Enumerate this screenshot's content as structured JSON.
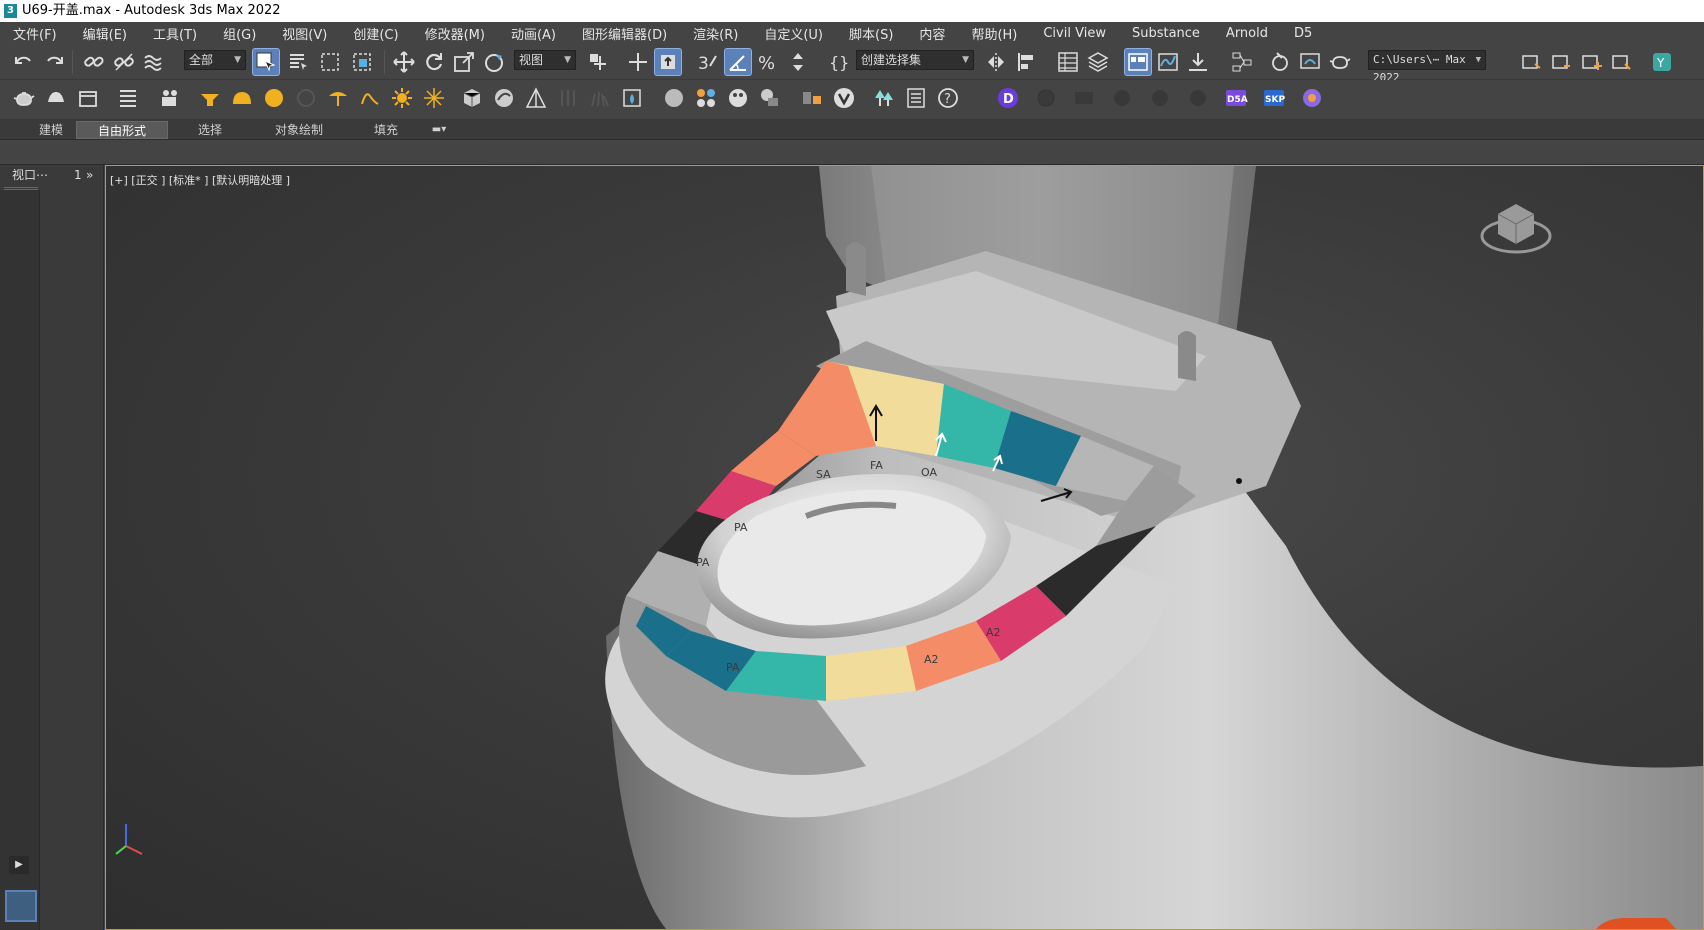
{
  "window": {
    "title": "U69-开盖.max - Autodesk 3ds Max 2022"
  },
  "menu": [
    "文件(F)",
    "编辑(E)",
    "工具(T)",
    "组(G)",
    "视图(V)",
    "创建(C)",
    "修改器(M)",
    "动画(A)",
    "图形编辑器(D)",
    "渲染(R)",
    "自定义(U)",
    "脚本(S)",
    "内容",
    "帮助(H)",
    "Civil View",
    "Substance",
    "Arnold",
    "D5"
  ],
  "toolbar": {
    "filter_value": "全部",
    "refcoord_value": "视图",
    "selset_value": "创建选择集",
    "path_value": "C:\\Users\\⋯ Max 2022"
  },
  "ribbon": {
    "tabs": [
      "建模",
      "自由形式",
      "选择",
      "对象绘制",
      "填充"
    ],
    "selected": "自由形式"
  },
  "leftpanel": {
    "label": "视口⋯",
    "num": "1"
  },
  "viewport": {
    "label": "[+] [正交 ] [标准* ] [默认明暗处理 ]"
  },
  "seat": {
    "segment_colors": [
      "#1a6f8a",
      "#34b7a8",
      "#f2dc9b",
      "#f58c68",
      "#d93b6a",
      "#2b2b2b",
      "#9a9a9a",
      "#b0b0b0"
    ],
    "ring_labels": [
      "SA",
      "FA",
      "OA",
      "PA",
      "PA",
      "PA",
      "A2",
      "A2"
    ]
  }
}
